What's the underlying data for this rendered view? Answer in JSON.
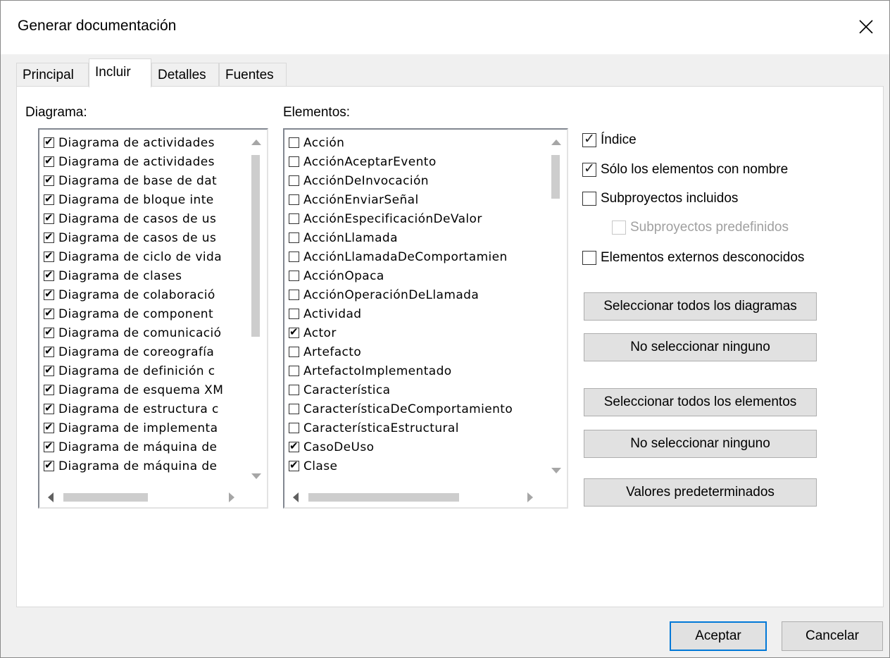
{
  "dialog": {
    "title": "Generar documentación"
  },
  "tabs": [
    {
      "label": "Principal"
    },
    {
      "label": "Incluir"
    },
    {
      "label": "Detalles"
    },
    {
      "label": "Fuentes"
    }
  ],
  "diagrams": {
    "label": "Diagrama:",
    "items": [
      {
        "label": "Diagrama de actividades",
        "checked": true
      },
      {
        "label": "Diagrama de actividades",
        "checked": true
      },
      {
        "label": "Diagrama de base de dat",
        "checked": true
      },
      {
        "label": "Diagrama de bloque inte",
        "checked": true
      },
      {
        "label": "Diagrama de casos de us",
        "checked": true
      },
      {
        "label": "Diagrama de casos de us",
        "checked": true
      },
      {
        "label": "Diagrama de ciclo de vida",
        "checked": true
      },
      {
        "label": "Diagrama de clases",
        "checked": true
      },
      {
        "label": "Diagrama de colaboració",
        "checked": true
      },
      {
        "label": "Diagrama de component",
        "checked": true
      },
      {
        "label": "Diagrama de comunicació",
        "checked": true
      },
      {
        "label": "Diagrama de coreografía",
        "checked": true
      },
      {
        "label": "Diagrama de definición c",
        "checked": true
      },
      {
        "label": "Diagrama de esquema XM",
        "checked": true
      },
      {
        "label": "Diagrama de estructura c",
        "checked": true
      },
      {
        "label": "Diagrama de implementa",
        "checked": true
      },
      {
        "label": "Diagrama de máquina de",
        "checked": true
      },
      {
        "label": "Diagrama de máquina de",
        "checked": true
      }
    ]
  },
  "elements": {
    "label": "Elementos:",
    "items": [
      {
        "label": "Acción",
        "checked": false
      },
      {
        "label": "AcciónAceptarEvento",
        "checked": false
      },
      {
        "label": "AcciónDeInvocación",
        "checked": false
      },
      {
        "label": "AcciónEnviarSeñal",
        "checked": false
      },
      {
        "label": "AcciónEspecificaciónDeValor",
        "checked": false
      },
      {
        "label": "AcciónLlamada",
        "checked": false
      },
      {
        "label": "AcciónLlamadaDeComportamien",
        "checked": false
      },
      {
        "label": "AcciónOpaca",
        "checked": false
      },
      {
        "label": "AcciónOperaciónDeLlamada",
        "checked": false
      },
      {
        "label": "Actividad",
        "checked": false
      },
      {
        "label": "Actor",
        "checked": true
      },
      {
        "label": "Artefacto",
        "checked": false
      },
      {
        "label": "ArtefactoImplementado",
        "checked": false
      },
      {
        "label": "Característica",
        "checked": false
      },
      {
        "label": "CaracterísticaDeComportamiento",
        "checked": false
      },
      {
        "label": "CaracterísticaEstructural",
        "checked": false
      },
      {
        "label": "CasoDeUso",
        "checked": true
      },
      {
        "label": "Clase",
        "checked": true
      }
    ]
  },
  "options": {
    "indice": {
      "label": "Índice",
      "checked": true
    },
    "solo_nombre": {
      "label": "Sólo los elementos con nombre",
      "checked": true
    },
    "subproyectos": {
      "label": "Subproyectos incluidos",
      "checked": false
    },
    "subproyectos_predef": {
      "label": "Subproyectos predefinidos",
      "checked": false,
      "disabled": true
    },
    "externos": {
      "label": "Elementos externos desconocidos",
      "checked": false
    }
  },
  "buttons": {
    "select_all_diagrams": "Seleccionar todos los diagramas",
    "select_none_diagrams": "No seleccionar ninguno",
    "select_all_elements": "Seleccionar todos los elementos",
    "select_none_elements": "No seleccionar ninguno",
    "defaults": "Valores predeterminados",
    "ok": "Aceptar",
    "cancel": "Cancelar"
  },
  "icons": {
    "close": "close-icon",
    "check": "check-icon"
  },
  "colors": {
    "default_button_border": "#0078d7",
    "title_bar": "#ffffff",
    "dialog_bg": "#f0f0f0"
  }
}
